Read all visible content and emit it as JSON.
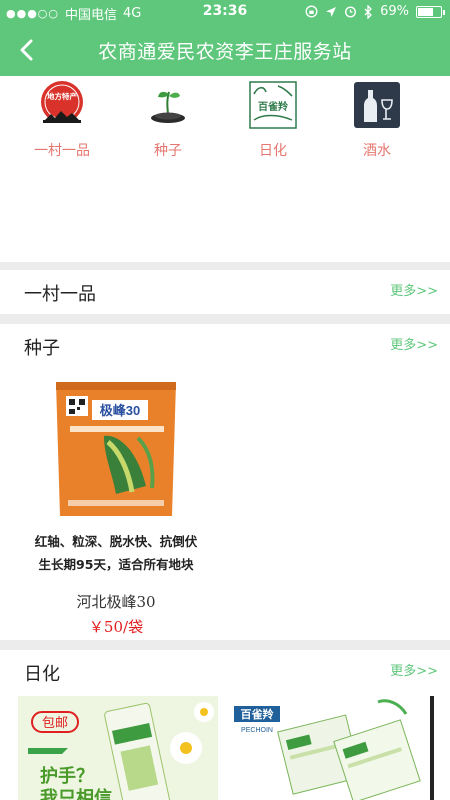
{
  "status_bar": {
    "signal": "●●●○○",
    "carrier": "中国电信",
    "network": "4G",
    "time": "23:36",
    "battery": "69%",
    "battery_level": 0.69
  },
  "nav": {
    "title": "农商通爱民农资李王庄服务站"
  },
  "categories": [
    {
      "label": "一村一品",
      "icon": "local-specialty-icon",
      "icon_text": "地方特产"
    },
    {
      "label": "种子",
      "icon": "seedling-icon"
    },
    {
      "label": "日化",
      "icon": "pechoin-logo-icon",
      "icon_text": "百雀羚"
    },
    {
      "label": "酒水",
      "icon": "wine-bottle-icon"
    }
  ],
  "sections": [
    {
      "name": "一村一品",
      "more": "更多>>"
    },
    {
      "name": "种子",
      "more": "更多>>"
    },
    {
      "name": "日化",
      "more": "更多>>"
    }
  ],
  "seed_product": {
    "desc_line1": "红轴、粒深、脱水快、抗倒伏",
    "desc_line2": "生长期95天，适合所有地块",
    "name": "河北极峰30",
    "price": "￥50/袋",
    "pack_brand": "极峰30"
  },
  "daily_products": [
    {
      "badge": "包邮",
      "slogan": "护手？",
      "slogan2": "我只相信"
    },
    {
      "brand": "百雀羚",
      "brand_en": "PECHOIN"
    }
  ],
  "colors": {
    "primary": "#5fc77c",
    "category_label": "#e5766f",
    "price": "#e02020",
    "divider": "#ececec"
  }
}
